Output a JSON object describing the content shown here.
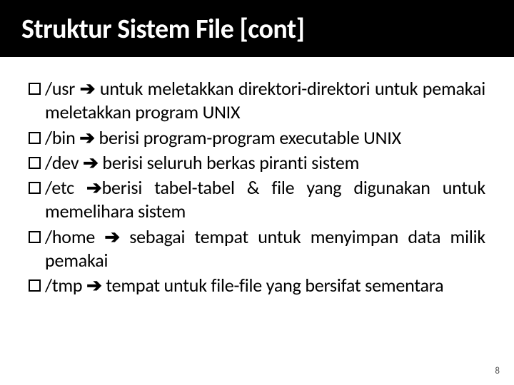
{
  "slide": {
    "title": "Struktur Sistem File [cont]",
    "page_number": "8",
    "bullets": [
      {
        "path": "/usr",
        "arrow": "➔",
        "desc": " untuk meletakkan direktori-direktori untuk pemakai meletakkan program UNIX"
      },
      {
        "path": "/bin",
        "arrow": "➔",
        "desc": " berisi program-program executable UNIX"
      },
      {
        "path": "/dev",
        "arrow": "➔",
        "desc": " berisi seluruh berkas piranti sistem"
      },
      {
        "path": "/etc",
        "arrow": "➔",
        "desc": "berisi tabel-tabel & file yang digunakan untuk memelihara sistem"
      },
      {
        "path": "/home",
        "arrow": "➔",
        "desc": " sebagai tempat untuk menyimpan data milik pemakai"
      },
      {
        "path": "/tmp",
        "arrow": "➔",
        "desc": " tempat untuk file-file yang bersifat sementara"
      }
    ]
  }
}
